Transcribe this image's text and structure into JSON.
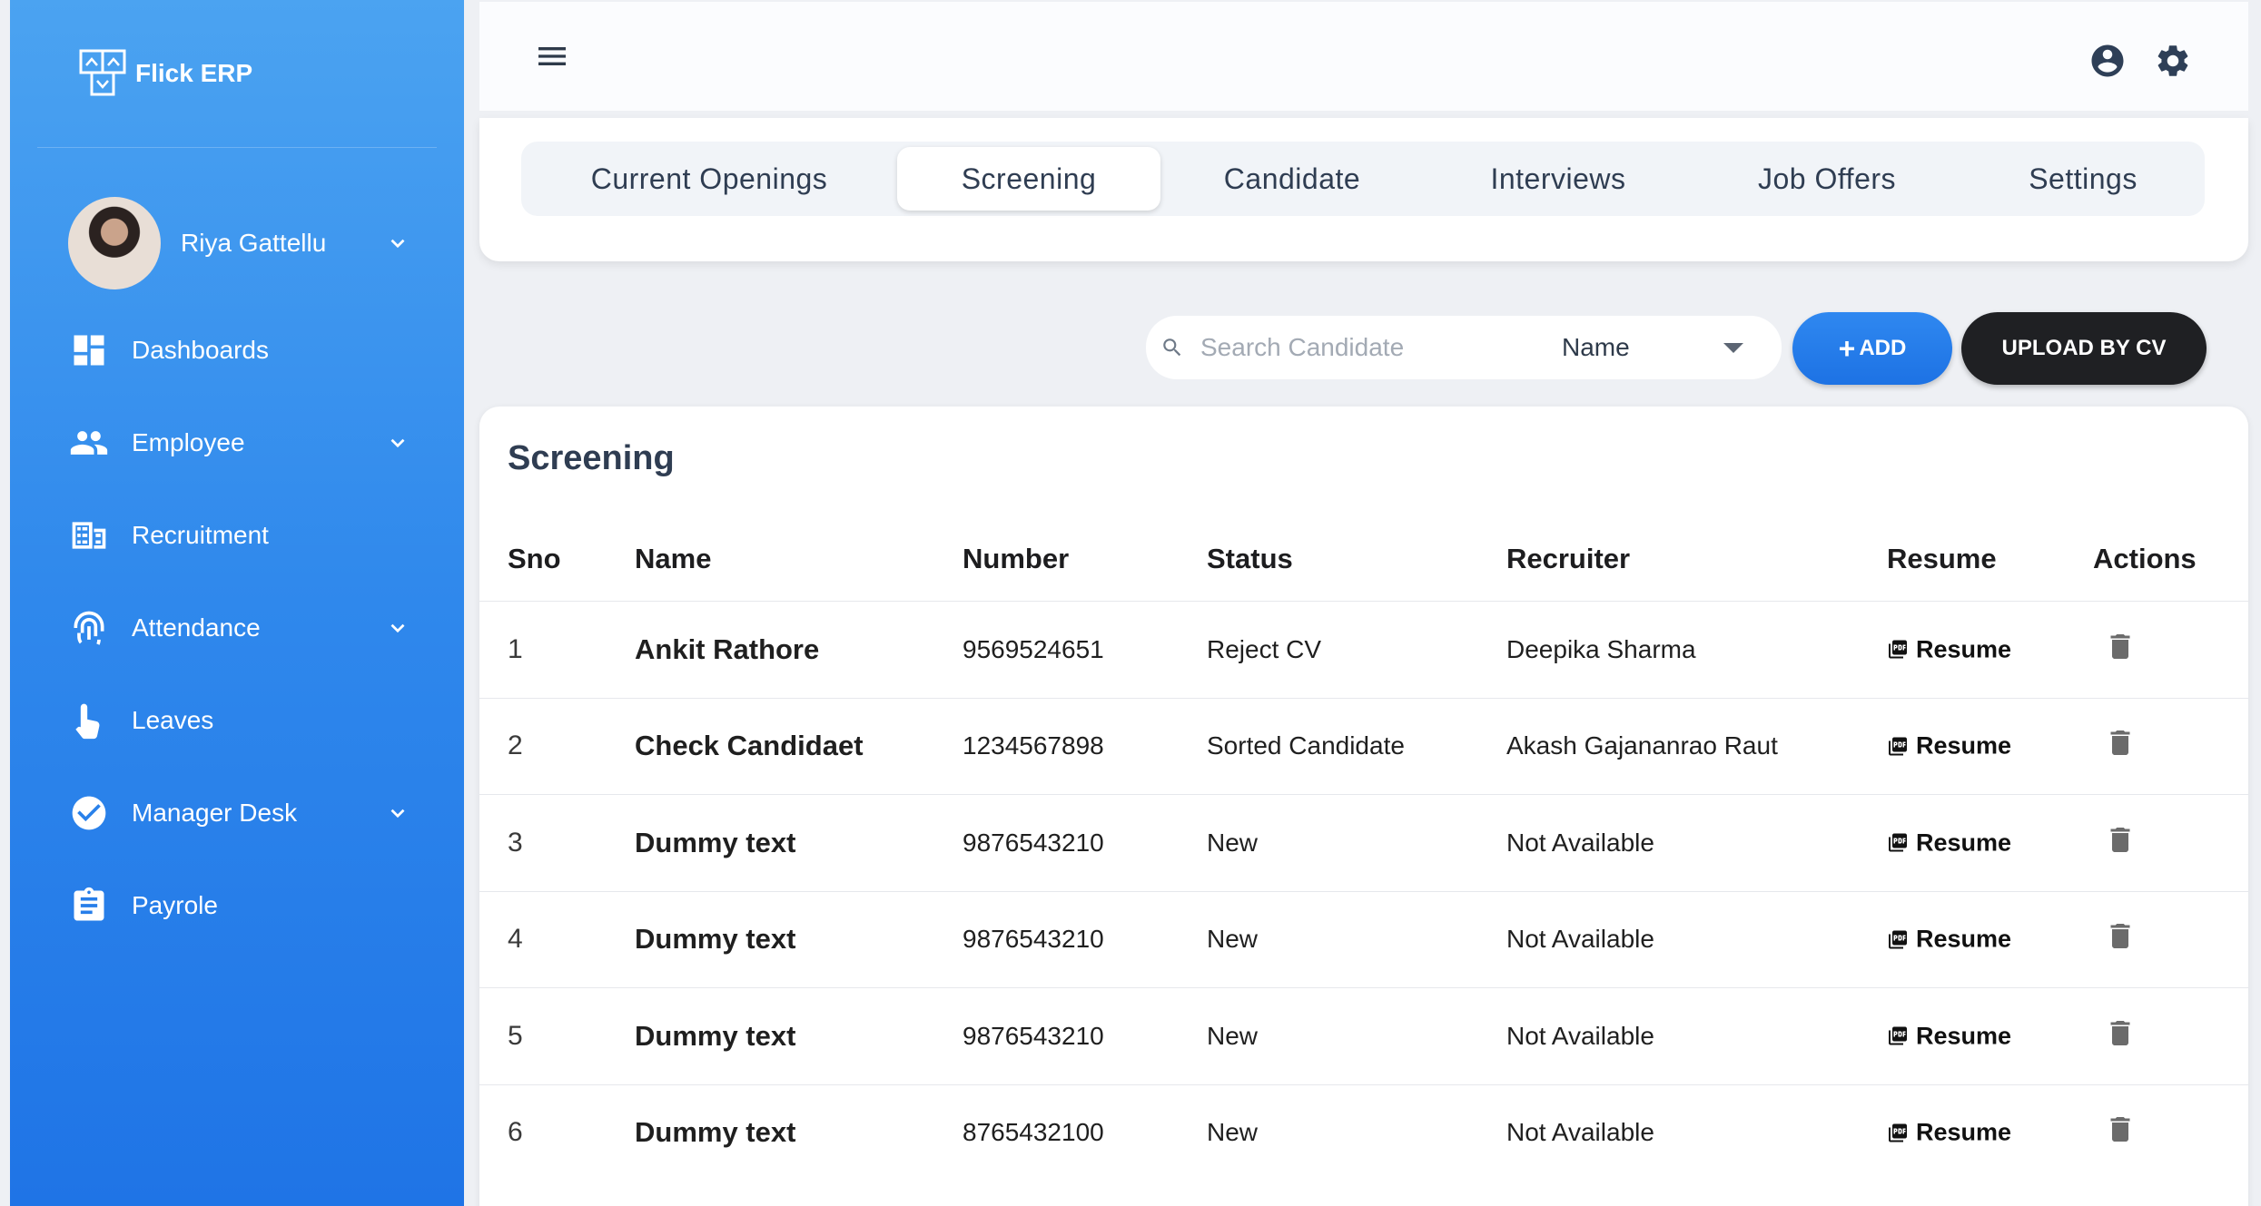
{
  "app": {
    "name": "Flick ERP"
  },
  "user": {
    "name": "Riya Gattellu"
  },
  "sidebar": {
    "items": [
      {
        "label": "Dashboards",
        "icon": "dashboard-icon",
        "has_submenu": false
      },
      {
        "label": "Employee",
        "icon": "people-icon",
        "has_submenu": true
      },
      {
        "label": "Recruitment",
        "icon": "recruitment-icon",
        "has_submenu": false
      },
      {
        "label": "Attendance",
        "icon": "fingerprint-icon",
        "has_submenu": true
      },
      {
        "label": "Leaves",
        "icon": "touch-icon",
        "has_submenu": false
      },
      {
        "label": "Manager Desk",
        "icon": "check-circle-icon",
        "has_submenu": true
      },
      {
        "label": "Payrole",
        "icon": "clipboard-icon",
        "has_submenu": false
      }
    ]
  },
  "header": {
    "menu_icon": "menu-icon",
    "account_icon": "account-icon",
    "settings_icon": "gear-icon"
  },
  "tabs": [
    {
      "label": "Current Openings",
      "active": false
    },
    {
      "label": "Screening",
      "active": true
    },
    {
      "label": "Candidate",
      "active": false
    },
    {
      "label": "Interviews",
      "active": false
    },
    {
      "label": "Job Offers",
      "active": false
    },
    {
      "label": "Settings",
      "active": false
    }
  ],
  "toolbar": {
    "search_placeholder": "Search Candidate",
    "search_value": "",
    "filter_value": "Name",
    "add_label": "ADD",
    "upload_label": "UPLOAD BY CV"
  },
  "table": {
    "title": "Screening",
    "columns": [
      "Sno",
      "Name",
      "Number",
      "Status",
      "Recruiter",
      "Resume",
      "Actions"
    ],
    "rows": [
      {
        "sno": "1",
        "name": "Ankit Rathore",
        "number": "9569524651",
        "status": "Reject CV",
        "recruiter": "Deepika Sharma",
        "resume": "Resume"
      },
      {
        "sno": "2",
        "name": "Check Candidaet",
        "number": "1234567898",
        "status": "Sorted Candidate",
        "recruiter": "Akash Gajananrao Raut",
        "resume": "Resume"
      },
      {
        "sno": "3",
        "name": "Dummy text",
        "number": "9876543210",
        "status": "New",
        "recruiter": "Not Available",
        "resume": "Resume"
      },
      {
        "sno": "4",
        "name": "Dummy text",
        "number": "9876543210",
        "status": "New",
        "recruiter": "Not Available",
        "resume": "Resume"
      },
      {
        "sno": "5",
        "name": "Dummy text",
        "number": "9876543210",
        "status": "New",
        "recruiter": "Not Available",
        "resume": "Resume"
      },
      {
        "sno": "6",
        "name": "Dummy text",
        "number": "8765432100",
        "status": "New",
        "recruiter": "Not Available",
        "resume": "Resume"
      }
    ]
  },
  "colors": {
    "accent": "#1f74e6",
    "sidebar_top": "#4ba3f1",
    "dark_button": "#1f2023",
    "title": "#2f3d52"
  }
}
